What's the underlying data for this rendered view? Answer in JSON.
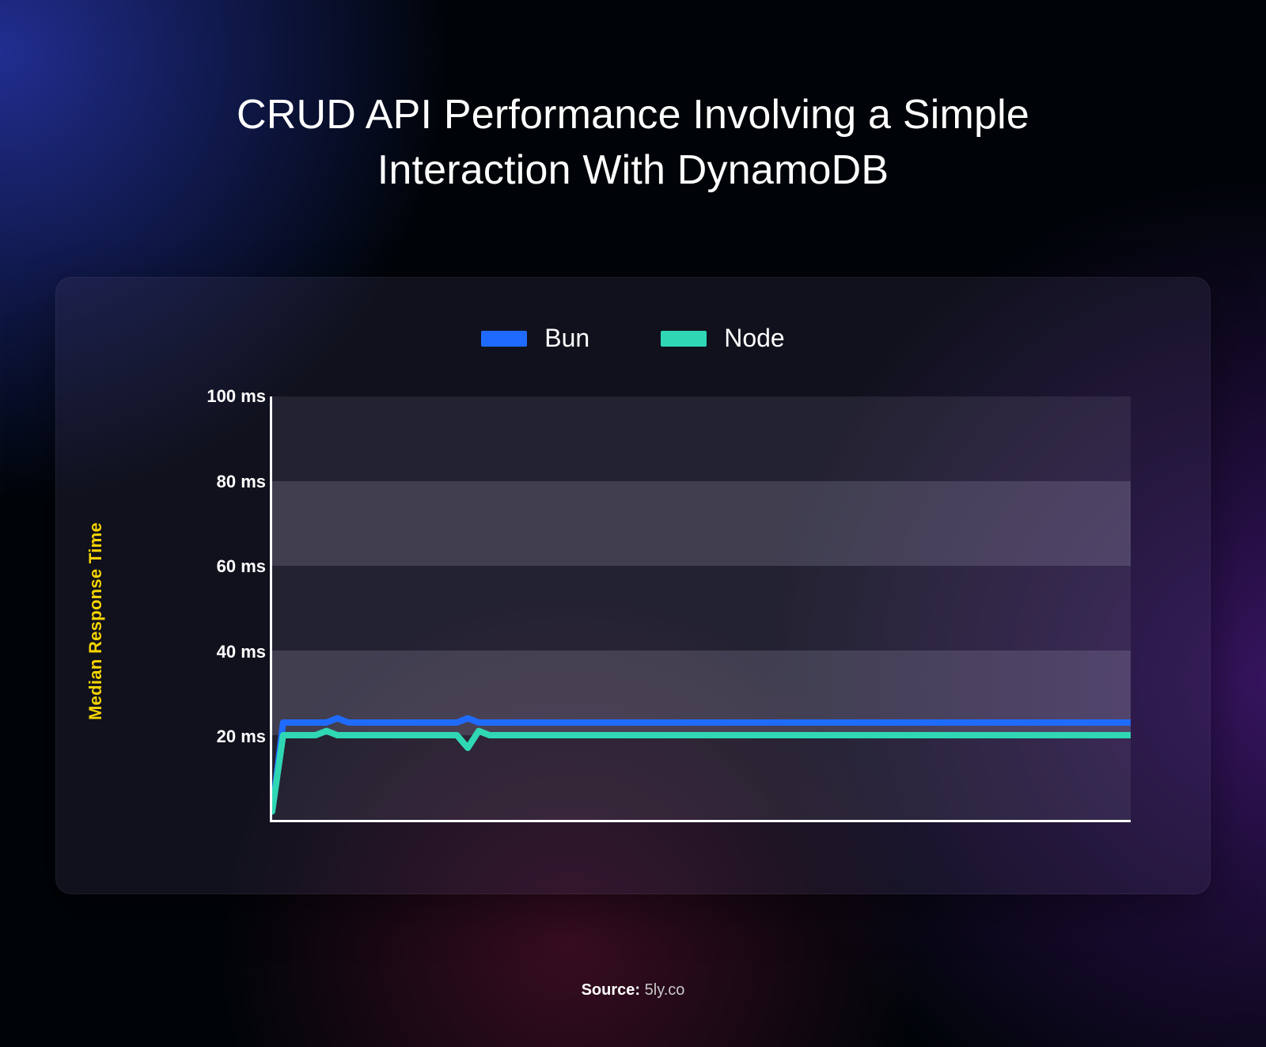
{
  "title": "CRUD API Performance Involving a Simple Interaction With DynamoDB",
  "legend": {
    "bun": {
      "label": "Bun",
      "color": "#1f6bff"
    },
    "node": {
      "label": "Node",
      "color": "#2fd7b5"
    }
  },
  "ylabel": "Median Response Time",
  "yticks": [
    "20 ms",
    "40 ms",
    "60 ms",
    "80 ms",
    "100 ms"
  ],
  "source_prefix": "Source:",
  "source_value": "5ly.co",
  "chart_data": {
    "type": "line",
    "title": "CRUD API Performance Involving a Simple Interaction With DynamoDB",
    "xlabel": "",
    "ylabel": "Median Response Time",
    "ylim": [
      0,
      100
    ],
    "yunit": "ms",
    "x": [
      0,
      1,
      2,
      3,
      4,
      5,
      6,
      7,
      8,
      9,
      10,
      11,
      12,
      13,
      14,
      15,
      16,
      17,
      18,
      19,
      20,
      21,
      22,
      23,
      24,
      25,
      26,
      27,
      28,
      29,
      30,
      31,
      32,
      33,
      34,
      35,
      36,
      37,
      38,
      39,
      40,
      41,
      42,
      43,
      44,
      45,
      46,
      47,
      48,
      49,
      50,
      51,
      52,
      53,
      54,
      55,
      56,
      57,
      58,
      59,
      60,
      61,
      62,
      63,
      64,
      65,
      66,
      67,
      68,
      69,
      70,
      71,
      72,
      73,
      74,
      75,
      76,
      77,
      78,
      79
    ],
    "series": [
      {
        "name": "Bun",
        "color": "#1f6bff",
        "values": [
          2,
          23,
          23,
          23,
          23,
          23,
          24,
          23,
          23,
          23,
          23,
          23,
          23,
          23,
          23,
          23,
          23,
          23,
          24,
          23,
          23,
          23,
          23,
          23,
          23,
          23,
          23,
          23,
          23,
          23,
          23,
          23,
          23,
          23,
          23,
          23,
          23,
          23,
          23,
          23,
          23,
          23,
          23,
          23,
          23,
          23,
          23,
          23,
          23,
          23,
          23,
          23,
          23,
          23,
          23,
          23,
          23,
          23,
          23,
          23,
          23,
          23,
          23,
          23,
          23,
          23,
          23,
          23,
          23,
          23,
          23,
          23,
          23,
          23,
          23,
          23,
          23,
          23,
          23,
          23
        ]
      },
      {
        "name": "Node",
        "color": "#2fd7b5",
        "values": [
          2,
          20,
          20,
          20,
          20,
          21,
          20,
          20,
          20,
          20,
          20,
          20,
          20,
          20,
          20,
          20,
          20,
          20,
          17,
          21,
          20,
          20,
          20,
          20,
          20,
          20,
          20,
          20,
          20,
          20,
          20,
          20,
          20,
          20,
          20,
          20,
          20,
          20,
          20,
          20,
          20,
          20,
          20,
          20,
          20,
          20,
          20,
          20,
          20,
          20,
          20,
          20,
          20,
          20,
          20,
          20,
          20,
          20,
          20,
          20,
          20,
          20,
          20,
          20,
          20,
          20,
          20,
          20,
          20,
          20,
          20,
          20,
          20,
          20,
          20,
          20,
          20,
          20,
          20,
          20
        ]
      }
    ]
  }
}
